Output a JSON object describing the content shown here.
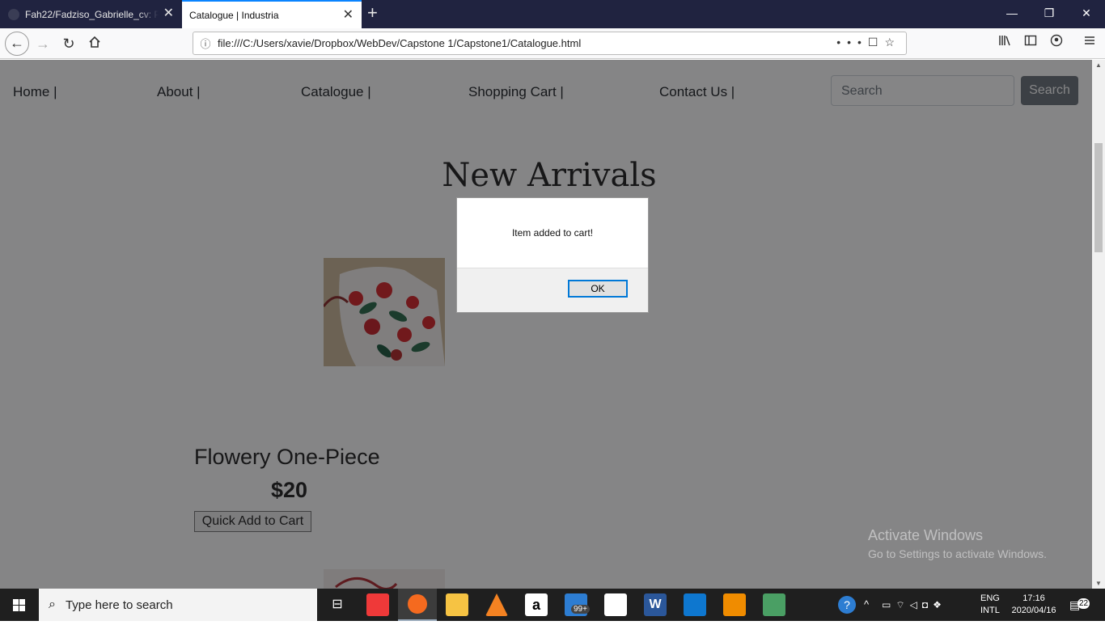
{
  "browser": {
    "tabs": [
      {
        "title": "Fah22/Fadziso_Gabrielle_cv: Pe",
        "active": false
      },
      {
        "title": "Catalogue | Industria",
        "active": true
      }
    ],
    "url": "file:///C:/Users/xavie/Dropbox/WebDev/Capstone 1/Capstone1/Catalogue.html"
  },
  "site": {
    "nav": [
      "Home |",
      "About |",
      "Catalogue |",
      "Shopping Cart |",
      "Contact Us |"
    ],
    "search_placeholder": "Search",
    "search_button": "Search",
    "heading": "New Arrivals",
    "product": {
      "name": "Flowery One-Piece",
      "price": "$20",
      "button": "Quick Add to Cart"
    }
  },
  "dialog": {
    "message": "Item added to cart!",
    "ok": "OK"
  },
  "watermark": {
    "line1": "Activate Windows",
    "line2": "Go to Settings to activate Windows."
  },
  "taskbar": {
    "search_placeholder": "Type here to search",
    "mail_badge": "99+",
    "lang1": "ENG",
    "lang2": "INTL",
    "time": "17:16",
    "date": "2020/04/16",
    "notif_count": "22"
  },
  "colors": {
    "titlebar": "#202340",
    "tab_accent": "#0a84ff",
    "search_button": "#6c757d",
    "taskbar": "#1f1f1f"
  }
}
